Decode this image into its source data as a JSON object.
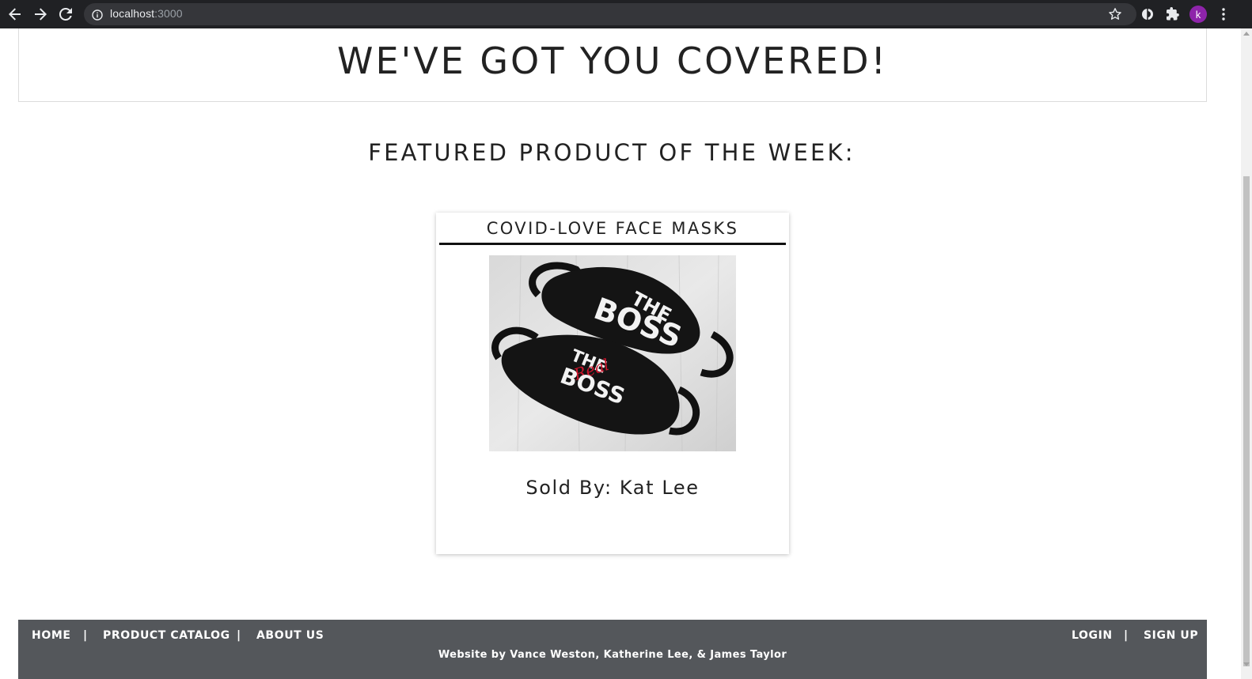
{
  "browser": {
    "url_host": "localhost",
    "url_port": ":3000",
    "profile_initial": "k",
    "icons": [
      "back-arrow-icon",
      "forward-arrow-icon",
      "reload-icon",
      "info-icon",
      "star-icon",
      "extension-icon",
      "puzzle-icon",
      "menu-icon"
    ]
  },
  "hero": {
    "title": "WE'VE GOT YOU COVERED!"
  },
  "featured": {
    "heading": "FEATURED PRODUCT OF THE WEEK:",
    "product_name": "COVID-LOVE FACE MASKS",
    "sold_by": "Sold By: Kat Lee",
    "mask_top_text": [
      "THE",
      "BOSS"
    ],
    "mask_bottom_text": [
      "THE",
      "Real",
      "BOSS"
    ]
  },
  "footer": {
    "left_links": [
      "HOME",
      "PRODUCT CATALOG",
      "ABOUT US"
    ],
    "separator": "|",
    "right_links": [
      "LOGIN",
      "SIGN UP"
    ],
    "credits": "Website by Vance Weston, Katherine Lee, & James Taylor"
  },
  "colors": {
    "chrome_bg": "#202124",
    "omnibox_bg": "#35363a",
    "footer_bg": "#54575b",
    "text_dark": "#222222",
    "accent_red": "#d0142c",
    "avatar_purple": "#8e24aa"
  }
}
